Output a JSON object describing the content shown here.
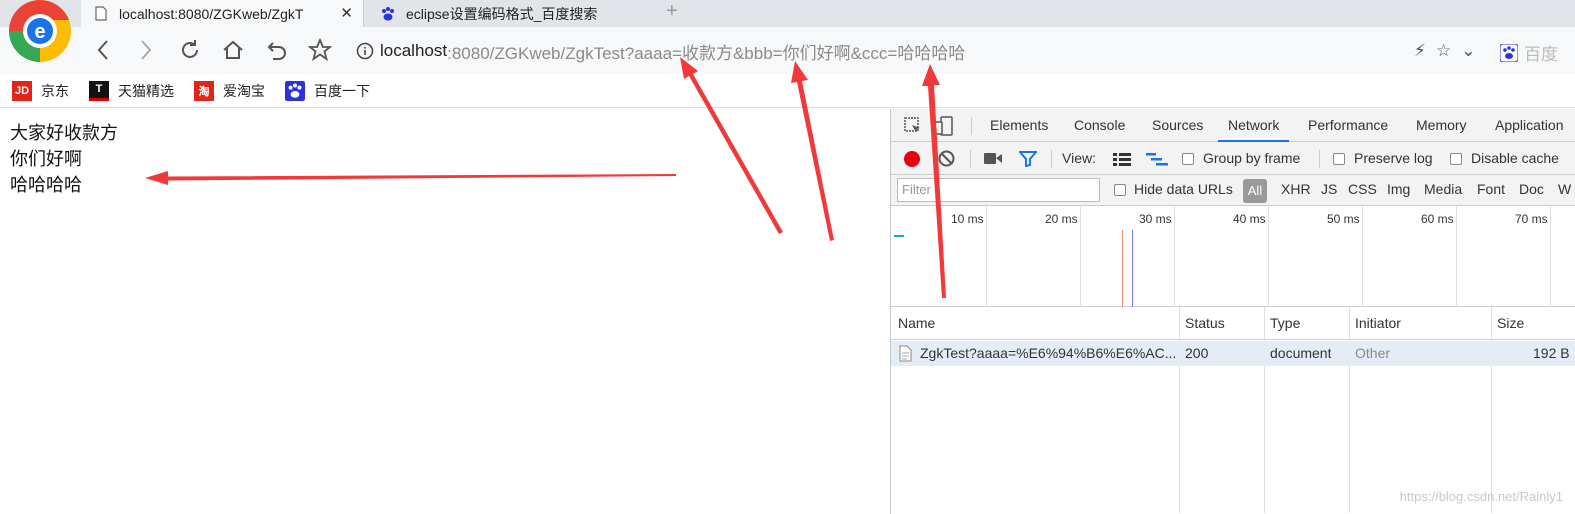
{
  "tabs": [
    {
      "title": "localhost:8080/ZGKweb/ZgkT",
      "close": "✕"
    },
    {
      "title": "eclipse设置编码格式_百度搜索"
    }
  ],
  "new_tab": "+",
  "address": {
    "host": "localhost",
    "rest": ":8080/ZGKweb/ZgkTest?aaaa=收款方&bbb=你们好啊&ccc=哈哈哈哈"
  },
  "search_engine_label": "百度",
  "bookmarks": [
    {
      "label": "京东",
      "icon_text": "JD",
      "color": "#e1251b"
    },
    {
      "label": "天猫精选",
      "icon_text": "T",
      "color": "#d00"
    },
    {
      "label": "爱淘宝",
      "icon_text": "淘",
      "color": "#e1251b"
    },
    {
      "label": "百度一下",
      "icon_text": "",
      "color": "#2932e1"
    }
  ],
  "page_lines": [
    "大家好收款方",
    "你们好啊",
    "哈哈哈哈"
  ],
  "devtools": {
    "tabs": [
      "Elements",
      "Console",
      "Sources",
      "Network",
      "Performance",
      "Memory",
      "Application"
    ],
    "active_tab": "Network",
    "view_label": "View:",
    "group_by_frame": "Group by frame",
    "preserve_log": "Preserve log",
    "disable_cache": "Disable cache",
    "filter_placeholder": "Filter",
    "hide_data_urls": "Hide data URLs",
    "type_filters": [
      "All",
      "XHR",
      "JS",
      "CSS",
      "Img",
      "Media",
      "Font",
      "Doc",
      "W"
    ],
    "timeline_ticks": [
      "10 ms",
      "20 ms",
      "30 ms",
      "40 ms",
      "50 ms",
      "60 ms",
      "70 ms"
    ],
    "columns": [
      "Name",
      "Status",
      "Type",
      "Initiator",
      "Size"
    ],
    "rows": [
      {
        "name": "ZgkTest?aaaa=%E6%94%B6%E6%AC...",
        "status": "200",
        "type": "document",
        "initiator": "Other",
        "size": "192 B"
      }
    ]
  },
  "watermark": "https://blog.csdn.net/Rainly1",
  "colors": {
    "arrow": "#f03a3a",
    "accent": "#1a73e8",
    "record": "#e8000d"
  }
}
